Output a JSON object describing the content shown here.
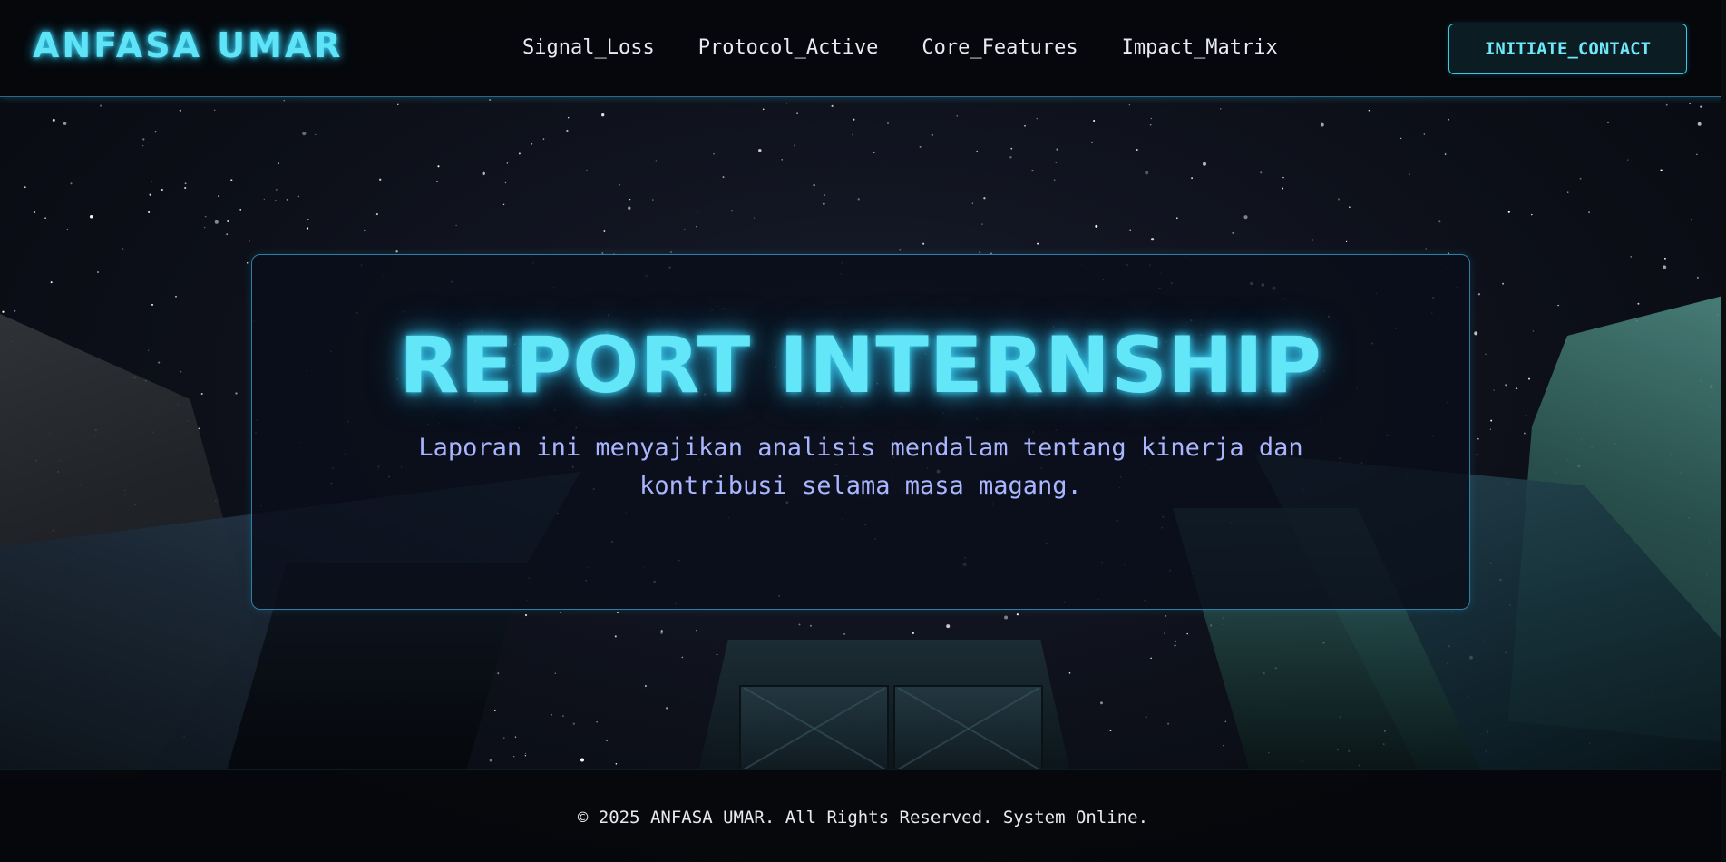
{
  "header": {
    "logo": "ANFASA UMAR",
    "nav": [
      "Signal_Loss",
      "Protocol_Active",
      "Core_Features",
      "Impact_Matrix"
    ],
    "cta_label": "INITIATE_CONTACT"
  },
  "hero": {
    "title": "REPORT INTERNSHIP",
    "subtitle_line1": "Laporan ini menyajikan analisis mendalam tentang kinerja dan",
    "subtitle_line2": "kontribusi selama masa magang."
  },
  "footer": {
    "copyright": "© 2025 ANFASA UMAR. All Rights Reserved. System Online."
  },
  "colors": {
    "accent": "#5fe3f7",
    "subtitle": "#a9b5ff",
    "border": "#2e7fa3",
    "background": "#05070c"
  }
}
